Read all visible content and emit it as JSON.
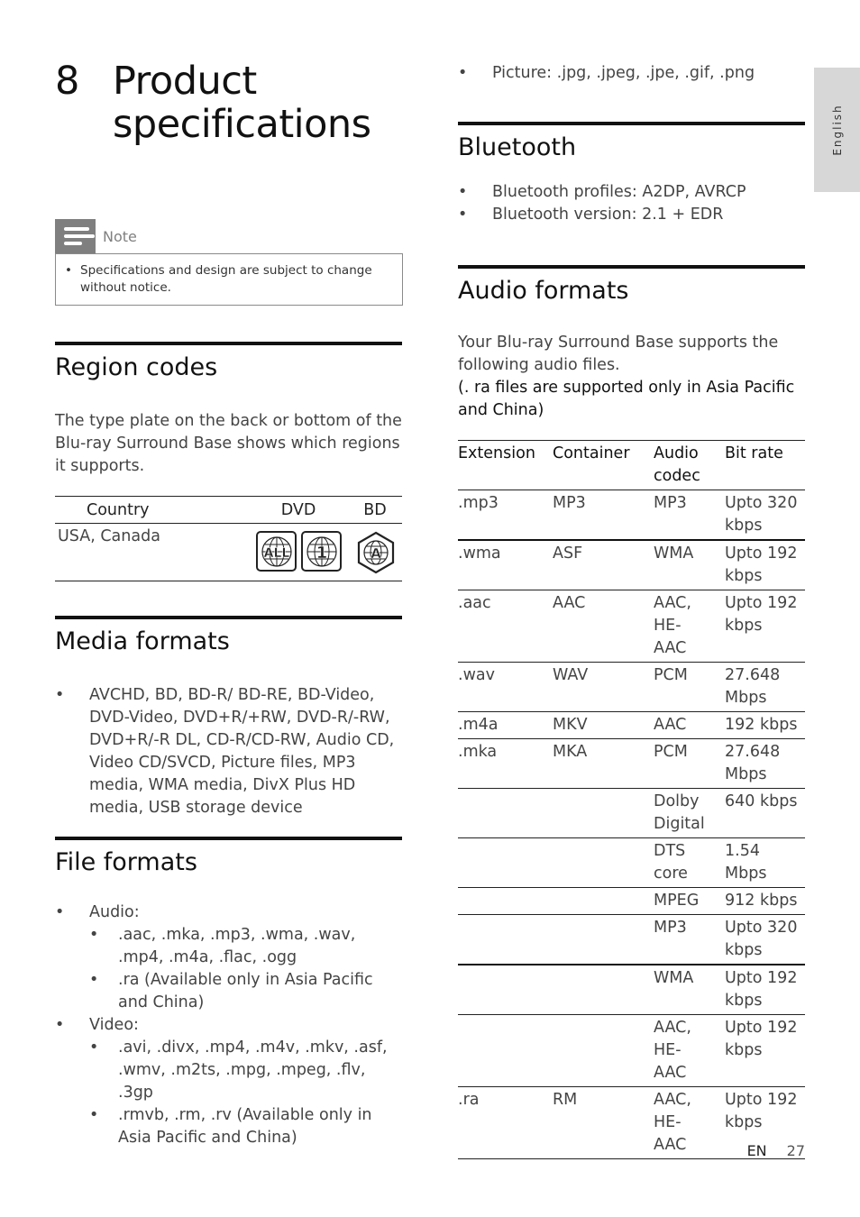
{
  "chapter": {
    "number": "8",
    "title": "Product specifications"
  },
  "note": {
    "label": "Note",
    "items": [
      "Specifications and design are subject to change without notice."
    ]
  },
  "region_codes": {
    "heading": "Region codes",
    "body": "The type plate on the back or bottom of the Blu-ray Surround Base  shows which regions it supports.",
    "columns": [
      "Country",
      "DVD",
      "BD"
    ],
    "rows": [
      {
        "country": "USA, Canada",
        "dvd_icons": [
          "ALL",
          "1"
        ],
        "bd_icon": "A"
      }
    ]
  },
  "media_formats": {
    "heading": "Media formats",
    "items": [
      "AVCHD, BD, BD-R/ BD-RE, BD-Video, DVD-Video, DVD+R/+RW, DVD-R/-RW, DVD+R/-R DL, CD-R/CD-RW, Audio CD, Video CD/SVCD, Picture files, MP3 media, WMA media, DivX Plus HD media, USB storage device"
    ]
  },
  "file_formats": {
    "heading": "File formats",
    "groups": [
      {
        "label": "Audio:",
        "items": [
          ".aac, .mka, .mp3, .wma, .wav, .mp4, .m4a, .flac, .ogg",
          ".ra (Available only in Asia Pacific and China)"
        ]
      },
      {
        "label": "Video:",
        "items": [
          ".avi, .divx, .mp4, .m4v, .mkv, .asf, .wmv, .m2ts, .mpg, .mpeg, .flv, .3gp",
          ".rmvb, .rm, .rv (Available only in Asia Pacific and China)"
        ]
      }
    ],
    "picture": "Picture: .jpg, .jpeg, .jpe, .gif, .png"
  },
  "bluetooth": {
    "heading": "Bluetooth",
    "items": [
      "Bluetooth profiles: A2DP, AVRCP",
      "Bluetooth version: 2.1 + EDR"
    ]
  },
  "audio_formats": {
    "heading": "Audio formats",
    "intro": "Your Blu-ray Surround Base  supports the following audio files.",
    "note": "(. ra files are supported only in Asia Pacific and China)",
    "columns": [
      "Extension",
      "Container",
      "Audio codec",
      "Bit rate"
    ],
    "rows": [
      [
        ".mp3",
        "MP3",
        "MP3",
        "Upto 320 kbps"
      ],
      [
        ".wma",
        "ASF",
        "WMA",
        "Upto 192 kbps"
      ],
      [
        ".aac",
        "AAC",
        "AAC, HE-AAC",
        "Upto 192 kbps"
      ],
      [
        ".wav",
        "WAV",
        "PCM",
        "27.648 Mbps"
      ],
      [
        ".m4a",
        "MKV",
        "AAC",
        "192 kbps"
      ],
      [
        ".mka",
        "MKA",
        "PCM",
        "27.648 Mbps"
      ],
      [
        "",
        "",
        "Dolby Digital",
        "640 kbps"
      ],
      [
        "",
        "",
        "DTS core",
        "1.54 Mbps"
      ],
      [
        "",
        "",
        "MPEG",
        "912 kbps"
      ],
      [
        "",
        "",
        "MP3",
        "Upto 320 kbps"
      ],
      [
        "",
        "",
        "WMA",
        "Upto 192 kbps"
      ],
      [
        "",
        "",
        "AAC, HE-AAC",
        "Upto 192 kbps"
      ],
      [
        ".ra",
        "RM",
        "AAC, HE-AAC",
        "Upto 192 kbps"
      ]
    ]
  },
  "side_tab": {
    "label": "English"
  },
  "footer": {
    "lang": "EN",
    "page": "27"
  }
}
